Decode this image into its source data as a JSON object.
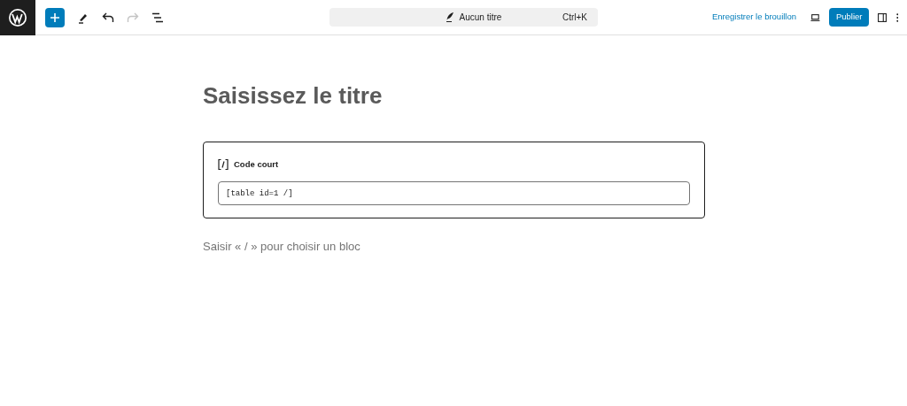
{
  "toolbar": {
    "tools": [
      {
        "kind": "add",
        "disabled": false
      },
      {
        "kind": "pen",
        "disabled": false
      },
      {
        "kind": "undo",
        "disabled": false
      },
      {
        "kind": "redo",
        "disabled": true
      },
      {
        "kind": "list",
        "disabled": false
      }
    ]
  },
  "command_bar": {
    "title": "Aucun titre",
    "shortcut": "Ctrl+K"
  },
  "actions": {
    "save_draft": "Enregistrer le brouillon",
    "publish": "Publier"
  },
  "editor": {
    "title_placeholder": "Saisissez le titre",
    "block": {
      "label": "Code court",
      "value": "[table id=1 /]"
    },
    "appender_placeholder": "Saisir « / » pour choisir un bloc"
  }
}
